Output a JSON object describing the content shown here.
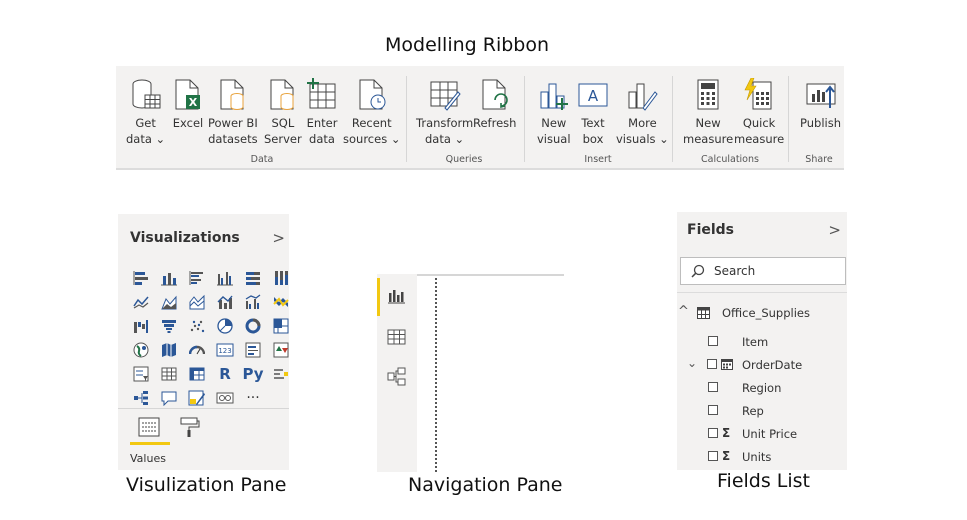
{
  "captions": {
    "ribbon": "Modelling Ribbon",
    "viz": "Visulization Pane",
    "nav": "Navigation Pane",
    "fields": "Fields List"
  },
  "colors": {
    "accent_yellow": "#f2c811",
    "icon_blue": "#2b5797",
    "excel_green": "#217346",
    "datasets_orange": "#e8a33d",
    "pane_bg": "#f3f2f1"
  },
  "ribbon": {
    "groups": [
      {
        "label": "Data",
        "buttons": [
          {
            "l1": "Get",
            "l2": "data ⌄",
            "icon": "database-icon"
          },
          {
            "l1": "Excel",
            "l2": "",
            "icon": "excel-icon"
          },
          {
            "l1": "Power BI",
            "l2": "datasets",
            "icon": "powerbi-datasets-icon"
          },
          {
            "l1": "SQL",
            "l2": "Server",
            "icon": "sql-server-icon"
          },
          {
            "l1": "Enter",
            "l2": "data",
            "icon": "enter-data-icon"
          },
          {
            "l1": "Recent",
            "l2": "sources ⌄",
            "icon": "recent-sources-icon"
          }
        ]
      },
      {
        "label": "Queries",
        "buttons": [
          {
            "l1": "Transform",
            "l2": "data ⌄",
            "icon": "transform-data-icon"
          },
          {
            "l1": "Refresh",
            "l2": "",
            "icon": "refresh-icon"
          }
        ]
      },
      {
        "label": "Insert",
        "buttons": [
          {
            "l1": "New",
            "l2": "visual",
            "icon": "new-visual-icon"
          },
          {
            "l1": "Text",
            "l2": "box",
            "icon": "text-box-icon"
          },
          {
            "l1": "More",
            "l2": "visuals ⌄",
            "icon": "more-visuals-icon"
          }
        ]
      },
      {
        "label": "Calculations",
        "buttons": [
          {
            "l1": "New",
            "l2": "measure",
            "icon": "calculator-icon"
          },
          {
            "l1": "Quick",
            "l2": "measure",
            "icon": "quick-measure-icon"
          }
        ]
      },
      {
        "label": "Share",
        "buttons": [
          {
            "l1": "Publish",
            "l2": "",
            "icon": "publish-icon"
          }
        ]
      }
    ]
  },
  "viz": {
    "title": "Visualizations",
    "chevron": ">",
    "text_icons": {
      "r": "R",
      "py": "Py",
      "more": "···"
    },
    "values_label": "Values"
  },
  "fields": {
    "title": "Fields",
    "chevron": ">",
    "search_placeholder": "Search",
    "table": {
      "expander": "^",
      "name": "Office_Supplies"
    },
    "items": [
      {
        "name": "Item",
        "sigma": false,
        "calendar": false,
        "expander": ""
      },
      {
        "name": "OrderDate",
        "sigma": false,
        "calendar": true,
        "expander": "⌄"
      },
      {
        "name": "Region",
        "sigma": false,
        "calendar": false,
        "expander": ""
      },
      {
        "name": "Rep",
        "sigma": false,
        "calendar": false,
        "expander": ""
      },
      {
        "name": "Unit Price",
        "sigma": true,
        "calendar": false,
        "expander": ""
      },
      {
        "name": "Units",
        "sigma": true,
        "calendar": false,
        "expander": ""
      }
    ],
    "sigma_symbol": "Σ"
  }
}
